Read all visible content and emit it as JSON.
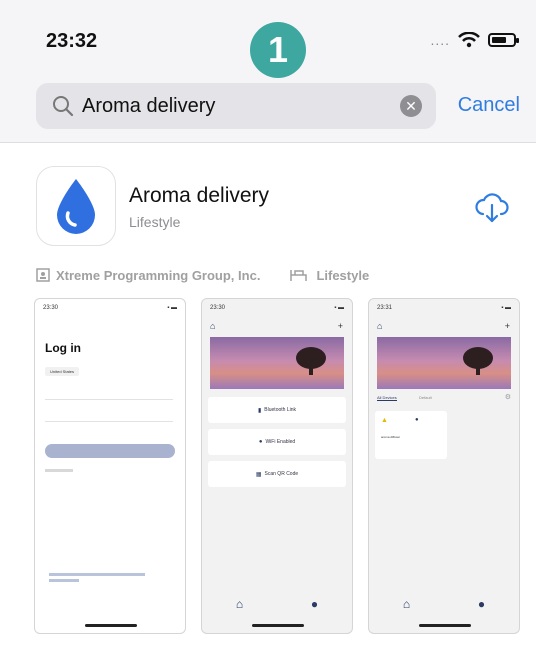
{
  "status_bar": {
    "time": "23:32",
    "signal": "....",
    "wifi_icon": "wifi-icon",
    "battery_icon": "battery-icon"
  },
  "step_badge": "1",
  "search": {
    "query": "Aroma delivery",
    "cancel_label": "Cancel",
    "icon": "search-icon",
    "clear_icon": "clear-icon"
  },
  "app": {
    "name": "Aroma delivery",
    "category": "Lifestyle",
    "icon": "water-drop-icon",
    "download_icon": "cloud-download-icon",
    "developer": "Xtreme Programming Group, Inc.",
    "genre": "Lifestyle",
    "accent_color": "#2f7de1"
  },
  "screenshots": {
    "login": {
      "time": "23:30",
      "title": "Log in",
      "region": "United States"
    },
    "home": {
      "time": "23:30",
      "cards": [
        "Bluetooth Link",
        "WiFi Enabled",
        "Scan QR Code"
      ]
    },
    "devices": {
      "time": "23:31",
      "tabs": [
        "All Devices",
        "Default"
      ],
      "device_name": "aroma diffuser"
    }
  }
}
